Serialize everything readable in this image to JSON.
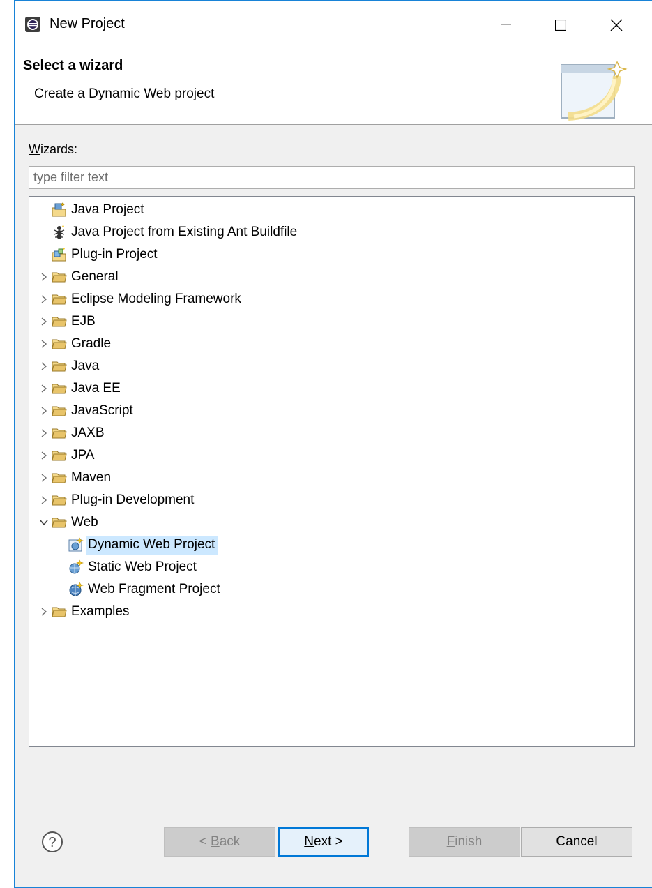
{
  "window": {
    "title": "New Project",
    "minimize_glyph": "—",
    "maximize_glyph": "☐",
    "close_glyph": "✕"
  },
  "banner": {
    "title": "Select a wizard",
    "description": "Create a Dynamic Web project"
  },
  "wizards": {
    "label_mnemonic": "W",
    "label_rest": "izards:",
    "filter_placeholder": "type filter text",
    "filter_value": ""
  },
  "tree": {
    "items": [
      {
        "label": "Java Project",
        "icon": "java-project-icon",
        "level": 0,
        "expandable": false
      },
      {
        "label": "Java Project from Existing Ant Buildfile",
        "icon": "ant-icon",
        "level": 0,
        "expandable": false
      },
      {
        "label": "Plug-in Project",
        "icon": "plugin-project-icon",
        "level": 0,
        "expandable": false
      },
      {
        "label": "General",
        "icon": "folder-icon",
        "level": 0,
        "expandable": true,
        "expanded": false
      },
      {
        "label": "Eclipse Modeling Framework",
        "icon": "folder-icon",
        "level": 0,
        "expandable": true,
        "expanded": false
      },
      {
        "label": "EJB",
        "icon": "folder-icon",
        "level": 0,
        "expandable": true,
        "expanded": false
      },
      {
        "label": "Gradle",
        "icon": "folder-icon",
        "level": 0,
        "expandable": true,
        "expanded": false
      },
      {
        "label": "Java",
        "icon": "folder-icon",
        "level": 0,
        "expandable": true,
        "expanded": false
      },
      {
        "label": "Java EE",
        "icon": "folder-icon",
        "level": 0,
        "expandable": true,
        "expanded": false
      },
      {
        "label": "JavaScript",
        "icon": "folder-icon",
        "level": 0,
        "expandable": true,
        "expanded": false
      },
      {
        "label": "JAXB",
        "icon": "folder-icon",
        "level": 0,
        "expandable": true,
        "expanded": false
      },
      {
        "label": "JPA",
        "icon": "folder-icon",
        "level": 0,
        "expandable": true,
        "expanded": false
      },
      {
        "label": "Maven",
        "icon": "folder-icon",
        "level": 0,
        "expandable": true,
        "expanded": false
      },
      {
        "label": "Plug-in Development",
        "icon": "folder-icon",
        "level": 0,
        "expandable": true,
        "expanded": false
      },
      {
        "label": "Web",
        "icon": "folder-icon",
        "level": 0,
        "expandable": true,
        "expanded": true
      },
      {
        "label": "Dynamic Web Project",
        "icon": "dynamic-web-project-icon",
        "level": 1,
        "expandable": false,
        "selected": true
      },
      {
        "label": "Static Web Project",
        "icon": "static-web-project-icon",
        "level": 1,
        "expandable": false
      },
      {
        "label": "Web Fragment Project",
        "icon": "web-fragment-project-icon",
        "level": 1,
        "expandable": false
      },
      {
        "label": "Examples",
        "icon": "folder-icon",
        "level": 0,
        "expandable": true,
        "expanded": false
      }
    ]
  },
  "buttons": {
    "back_prefix": "< ",
    "back_mnemonic": "B",
    "back_rest": "ack",
    "next_mnemonic": "N",
    "next_rest": "ext >",
    "finish_mnemonic": "F",
    "finish_rest": "inish",
    "cancel": "Cancel"
  },
  "colors": {
    "selection": "#cce8ff",
    "window_border": "#1883d7",
    "default_button_border": "#0078d7",
    "folder": "#e8c46a"
  }
}
